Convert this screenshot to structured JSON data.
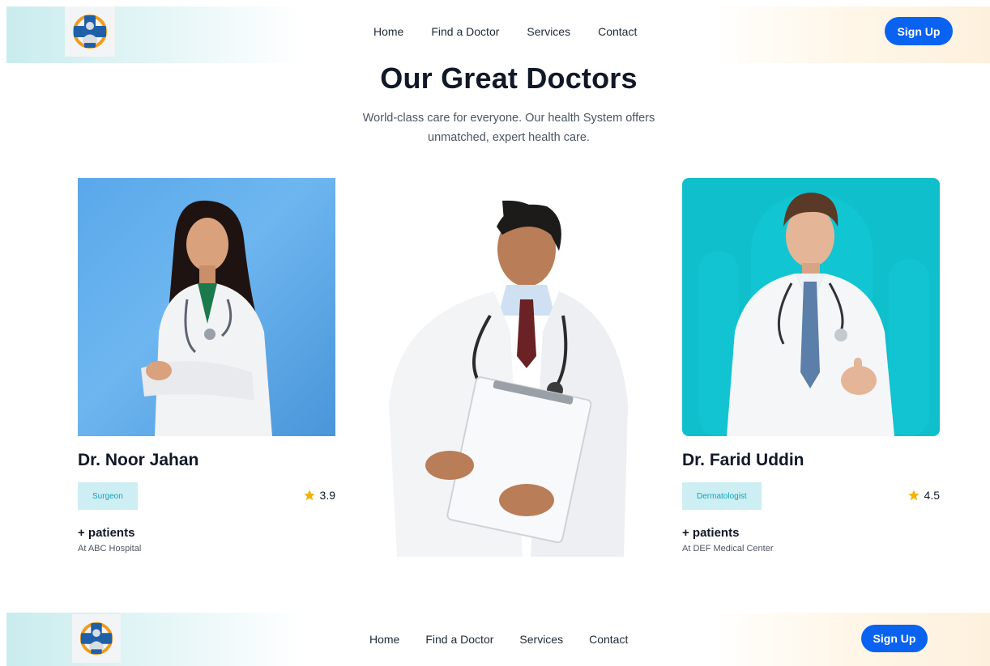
{
  "nav": {
    "links": [
      "Home",
      "Find a Doctor",
      "Services",
      "Contact"
    ],
    "signup_label": "Sign Up"
  },
  "hero": {
    "title": "Our Great Doctors",
    "subtitle": "World-class care for everyone. Our health System offers unmatched, expert health care."
  },
  "doctors": [
    {
      "name": "Dr. Noor Jahan",
      "specialty": "Surgeon",
      "rating": "3.9",
      "patients": "+ patients",
      "hospital": "At ABC Hospital"
    },
    {
      "name": "Dr. Farid Uddin",
      "specialty": "Dermatologist",
      "rating": "4.5",
      "patients": "+ patients",
      "hospital": "At DEF Medical Center"
    }
  ],
  "colors": {
    "accent": "#0a62f0",
    "badge_bg": "#cdeef3",
    "badge_text": "#14a3b8",
    "star": "#f5b301"
  },
  "icons": {
    "logo": "medical-cross-doctor-logo",
    "rating": "star-icon"
  }
}
